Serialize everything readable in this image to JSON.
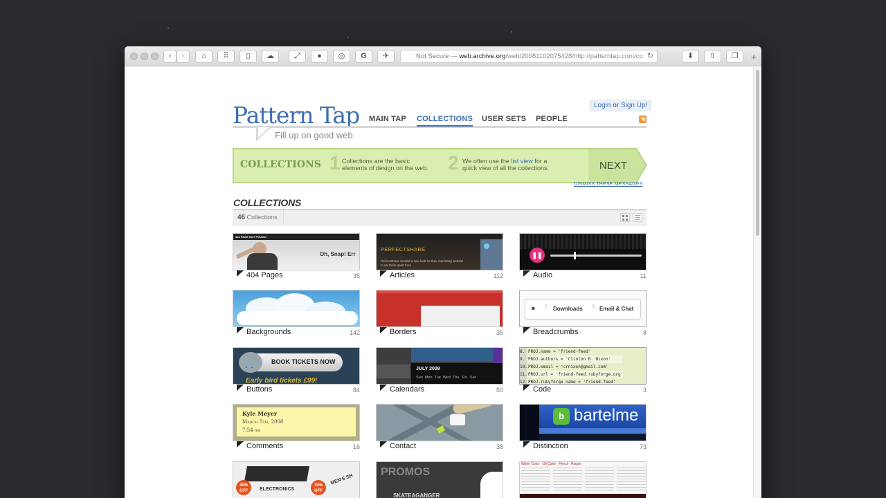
{
  "browser": {
    "url_prefix": "Not Secure — ",
    "url_host": "web.archive.org",
    "url_path": "/web/20081102075428/http://patterntap.com/co"
  },
  "site": {
    "logo": "Pattern Tap",
    "tagline": "Fill up on good web",
    "nav": [
      "MAIN TAP",
      "COLLECTIONS",
      "USER SETS",
      "PEOPLE"
    ],
    "login": "Login",
    "or": "or",
    "signup": "Sign Up!"
  },
  "banner": {
    "title": "COLLECTIONS",
    "step1_num": "1",
    "step1_text": "Collections are the basic elements of design on the web.",
    "step2_num": "2",
    "step2_pre": "We often use the ",
    "step2_link": "list view",
    "step2_post": " for a quick view of all the collections.",
    "next": "NEXT",
    "dismiss": "DISMISS THESE MESSAGES"
  },
  "collections": {
    "heading": "COLLECTIONS",
    "count_num": "46",
    "count_label": "Collections",
    "items": [
      {
        "name": "404 Pages",
        "count": "35"
      },
      {
        "name": "Articles",
        "count": "112"
      },
      {
        "name": "Audio",
        "count": "11"
      },
      {
        "name": "Backgrounds",
        "count": "142"
      },
      {
        "name": "Borders",
        "count": "35"
      },
      {
        "name": "Breadcrumbs",
        "count": "8"
      },
      {
        "name": "Buttons",
        "count": "84"
      },
      {
        "name": "Calendars",
        "count": "50"
      },
      {
        "name": "Code",
        "count": "3"
      },
      {
        "name": "Comments",
        "count": "16"
      },
      {
        "name": "Contact",
        "count": "38"
      },
      {
        "name": "Distinction",
        "count": "73"
      }
    ]
  },
  "thumbs": {
    "t404_top": "404 PAGE NOT FOUND!",
    "t404_big": "Oh, Snap! Err",
    "articles_brand": "PERFECTSHARE",
    "articles_text": "PerfectShare needed a new look for their marketing website to set them apart from",
    "crumb1": "Downloads",
    "crumb2": "Email & Chat",
    "button_label": "BOOK TICKETS NOW",
    "button_sub": "Early bird tickets £99!",
    "cal_month": "JULY 2008",
    "cal_days": "Sun  Mon  Tue  Wed  Thu   Fri   Sat",
    "code_lines": [
      "PROJ.name = 'friend-feed'",
      "PROJ.authors = 'Clinton R. Nixon'",
      "PROJ.email = 'crnixon@gmail.com'",
      "PROJ.url = 'friend-feed.rubyforge.org'",
      "PROJ.rubyforge_name = 'friend-feed'"
    ],
    "code_nums": [
      "8.",
      "9.",
      "10.",
      "11.",
      "12."
    ],
    "comment_name": "Kyle Meyer",
    "comment_date": "March 5th, 2008",
    "comment_time": "7:54 am",
    "distinction": "bartelme",
    "bottom1": "ELECTRONICS",
    "bottom1b": "MEN'S SH",
    "bottom1_off1": "20% OFF",
    "bottom1_off2": "15% OFF",
    "bottom2": "PROMOS",
    "bottom2b": "SKATEAGANGER",
    "bottom3": "Water Color   Oil Color   Pencil   Pagan"
  }
}
